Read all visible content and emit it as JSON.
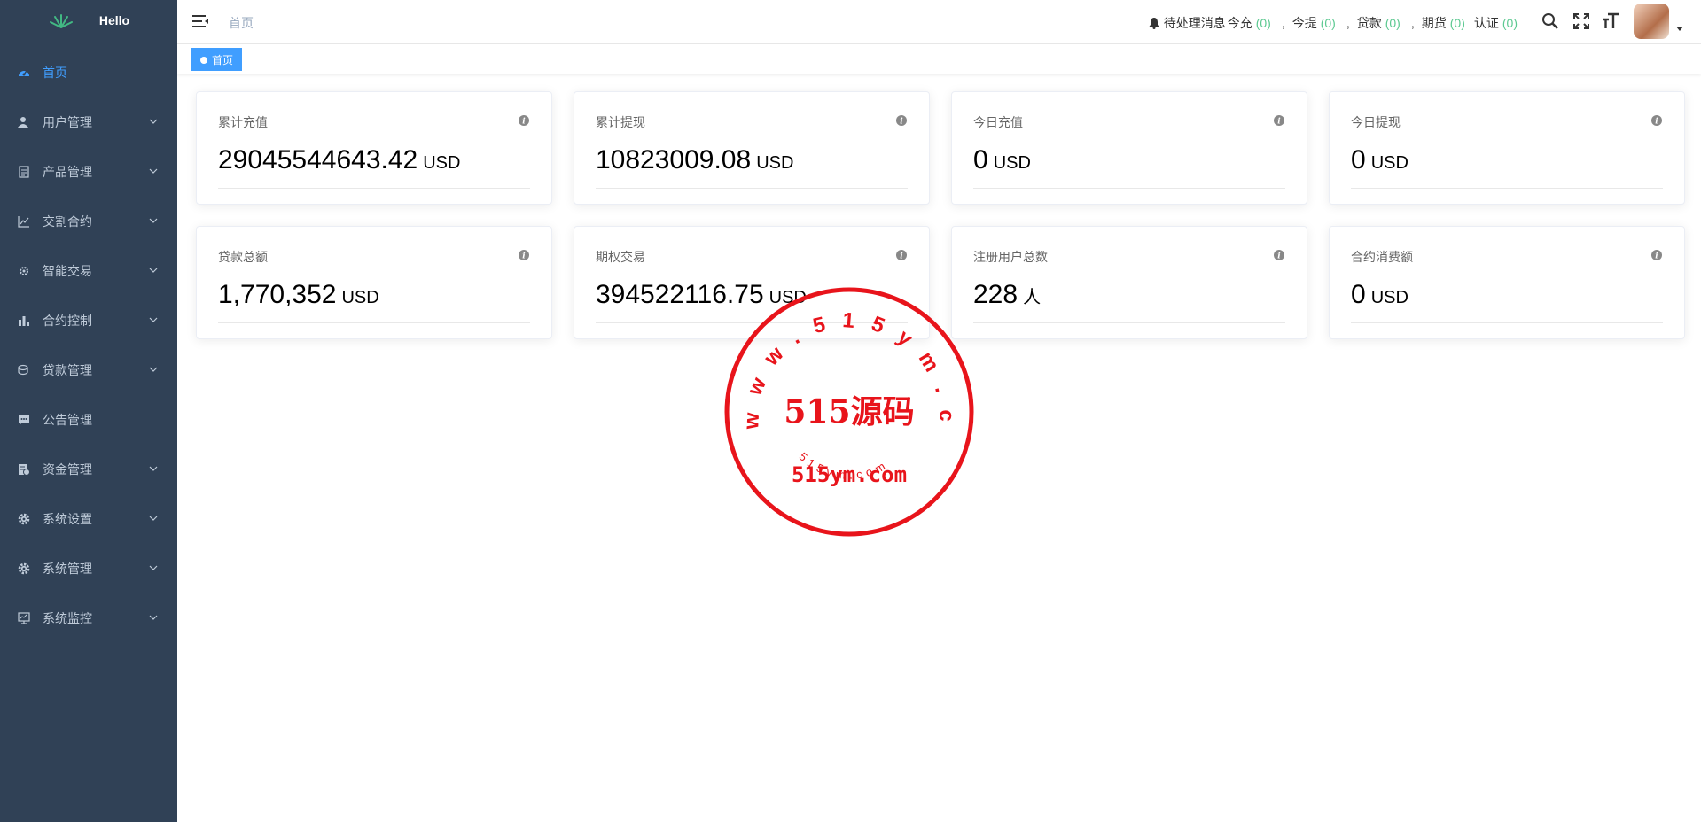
{
  "sidebar": {
    "logo_title": "Hello",
    "items": [
      {
        "label": "首页",
        "icon": "dashboard-icon",
        "active": true,
        "has_arrow": false
      },
      {
        "label": "用户管理",
        "icon": "users-icon",
        "has_arrow": true
      },
      {
        "label": "产品管理",
        "icon": "document-icon",
        "has_arrow": true
      },
      {
        "label": "交割合约",
        "icon": "chart-line-icon",
        "has_arrow": true
      },
      {
        "label": "智能交易",
        "icon": "gear-small-icon",
        "has_arrow": true
      },
      {
        "label": "合约控制",
        "icon": "bar-chart-icon",
        "has_arrow": true
      },
      {
        "label": "贷款管理",
        "icon": "coins-icon",
        "has_arrow": true
      },
      {
        "label": "公告管理",
        "icon": "message-icon",
        "has_arrow": false
      },
      {
        "label": "资金管理",
        "icon": "money-icon",
        "has_arrow": true
      },
      {
        "label": "系统设置",
        "icon": "settings-icon",
        "has_arrow": true
      },
      {
        "label": "系统管理",
        "icon": "settings-icon",
        "has_arrow": true
      },
      {
        "label": "系统监控",
        "icon": "monitor-icon",
        "has_arrow": true
      }
    ]
  },
  "navbar": {
    "breadcrumb": "首页",
    "notice_label": "待处理消息",
    "notices": [
      {
        "label": "今充",
        "count": "(0)"
      },
      {
        "label": "今提",
        "count": "(0)"
      },
      {
        "label": "贷款",
        "count": "(0)"
      },
      {
        "label": "期货",
        "count": "(0)"
      },
      {
        "label": "认证",
        "count": "(0)"
      }
    ],
    "separator": ","
  },
  "tagsview": {
    "active_tag": "首页"
  },
  "cards": [
    {
      "title": "累计充值",
      "value": "29045544643.42",
      "unit": "USD"
    },
    {
      "title": "累计提现",
      "value": "10823009.08",
      "unit": "USD"
    },
    {
      "title": "今日充值",
      "value": "0",
      "unit": "USD"
    },
    {
      "title": "今日提现",
      "value": "0",
      "unit": "USD"
    },
    {
      "title": "贷款总额",
      "value": "1,770,352",
      "unit": "USD"
    },
    {
      "title": "期权交易",
      "value": "394522116.75",
      "unit": "USD"
    },
    {
      "title": "注册用户总数",
      "value": "228",
      "unit": "人"
    },
    {
      "title": "合约消费额",
      "value": "0",
      "unit": "USD"
    }
  ],
  "watermark": {
    "ring_text": "www.515ym.com",
    "main_text": "515源码",
    "sub_text": "515ym.com",
    "bottom_text": "515ym.com",
    "color": "#e8141b"
  },
  "colors": {
    "sidebar_bg": "#304156",
    "active": "#409eff",
    "count": "#5cc991"
  }
}
